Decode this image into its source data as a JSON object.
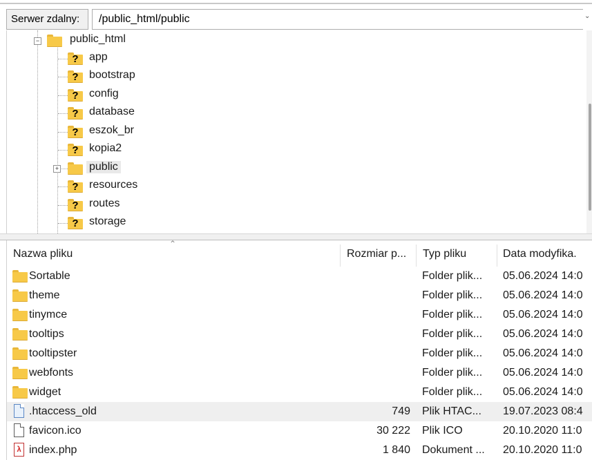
{
  "path_bar": {
    "label": "Serwer zdalny:",
    "path": "/public_html/public"
  },
  "tree": {
    "root": "public_html",
    "items": [
      {
        "label": "app",
        "icon": "unknown-folder-icon"
      },
      {
        "label": "bootstrap",
        "icon": "unknown-folder-icon"
      },
      {
        "label": "config",
        "icon": "unknown-folder-icon"
      },
      {
        "label": "database",
        "icon": "unknown-folder-icon"
      },
      {
        "label": "eszok_br",
        "icon": "unknown-folder-icon"
      },
      {
        "label": "kopia2",
        "icon": "unknown-folder-icon"
      },
      {
        "label": "public",
        "icon": "folder-icon"
      },
      {
        "label": "resources",
        "icon": "unknown-folder-icon"
      },
      {
        "label": "routes",
        "icon": "unknown-folder-icon"
      },
      {
        "label": "storage",
        "icon": "unknown-folder-icon"
      }
    ],
    "expander_collapsed": "+",
    "expander_expanded": "−"
  },
  "file_list": {
    "columns": {
      "name": "Nazwa pliku",
      "size": "Rozmiar p...",
      "type": "Typ pliku",
      "date": "Data modyfika."
    },
    "rows": [
      {
        "name": "Sortable",
        "size": "",
        "type": "Folder plik...",
        "date": "05.06.2024 14:0",
        "icon": "folder-icon"
      },
      {
        "name": "theme",
        "size": "",
        "type": "Folder plik...",
        "date": "05.06.2024 14:0",
        "icon": "folder-icon"
      },
      {
        "name": "tinymce",
        "size": "",
        "type": "Folder plik...",
        "date": "05.06.2024 14:0",
        "icon": "folder-icon"
      },
      {
        "name": "tooltips",
        "size": "",
        "type": "Folder plik...",
        "date": "05.06.2024 14:0",
        "icon": "folder-icon"
      },
      {
        "name": "tooltipster",
        "size": "",
        "type": "Folder plik...",
        "date": "05.06.2024 14:0",
        "icon": "folder-icon"
      },
      {
        "name": "webfonts",
        "size": "",
        "type": "Folder plik...",
        "date": "05.06.2024 14:0",
        "icon": "folder-icon"
      },
      {
        "name": "widget",
        "size": "",
        "type": "Folder plik...",
        "date": "05.06.2024 14:0",
        "icon": "folder-icon"
      },
      {
        "name": ".htaccess_old",
        "size": "749",
        "type": "Plik HTAC...",
        "date": "19.07.2023 08:4",
        "icon": "file-icon"
      },
      {
        "name": "favicon.ico",
        "size": "30 222",
        "type": "Plik ICO",
        "date": "20.10.2020 11:0",
        "icon": "file-icon"
      },
      {
        "name": "index.php",
        "size": "1 840",
        "type": "Dokument ...",
        "date": "20.10.2020 11:0",
        "icon": "pdf-file-icon"
      }
    ]
  },
  "colors": {
    "folder": "#f7c948",
    "row_highlight": "#efefef"
  }
}
